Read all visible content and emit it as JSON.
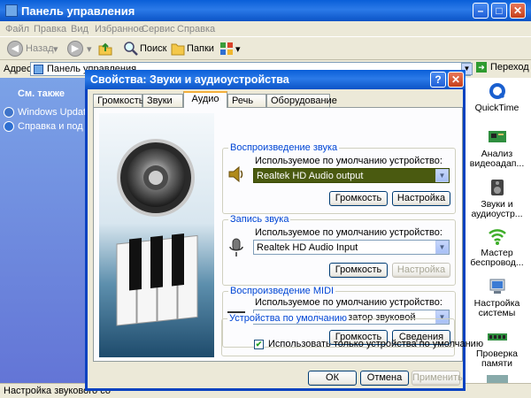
{
  "control_panel": {
    "title": "Панель управления",
    "menu": [
      "Файл",
      "Правка",
      "Вид",
      "Избранное",
      "Сервис",
      "Справка"
    ],
    "toolbar": {
      "back": "Назад",
      "search": "Поиск",
      "folders": "Папки"
    },
    "address_label": "Адрес:",
    "address_value": "Панель управления",
    "go": "Переход",
    "see_also_header": "См. также",
    "see_also_links": [
      "Windows Updat",
      "Справка и под"
    ],
    "right_items": [
      "QuickTime",
      "Анализ видеоадап...",
      "Звуки и аудиоустр...",
      "Мастер беспровод...",
      "Настройка системы",
      "Проверка памяти"
    ],
    "status": "Настройка звукового со"
  },
  "dialog": {
    "title": "Свойства: Звуки и аудиоустройства",
    "help": "?",
    "close": "✕",
    "tabs": [
      "Громкость",
      "Звуки",
      "Аудио",
      "Речь",
      "Оборудование"
    ],
    "active_tab": "Аудио",
    "playback": {
      "title": "Воспроизведение звука",
      "label": "Используемое по умолчанию устройство:",
      "device": "Realtek HD Audio output",
      "volume": "Громкость",
      "settings": "Настройка"
    },
    "recording": {
      "title": "Запись звука",
      "label": "Используемое по умолчанию устройство:",
      "device": "Realtek HD Audio Input",
      "volume": "Громкость",
      "settings": "Настройка"
    },
    "midi": {
      "title": "Воспроизведение MIDI",
      "label": "Используемое по умолчанию устройство:",
      "device": "Программный синтезатор звуковой",
      "volume": "Громкость",
      "about": "Сведения"
    },
    "defaults": {
      "title": "Устройства по умолчанию",
      "checkbox": "Использовать только устройства по умолчанию",
      "checked": true
    },
    "ok": "ОК",
    "cancel": "Отмена",
    "apply": "Применить"
  },
  "colors": {
    "title_bar": "#0a53c6",
    "highlight": "#ffff00",
    "group_title": "#0046d5"
  }
}
